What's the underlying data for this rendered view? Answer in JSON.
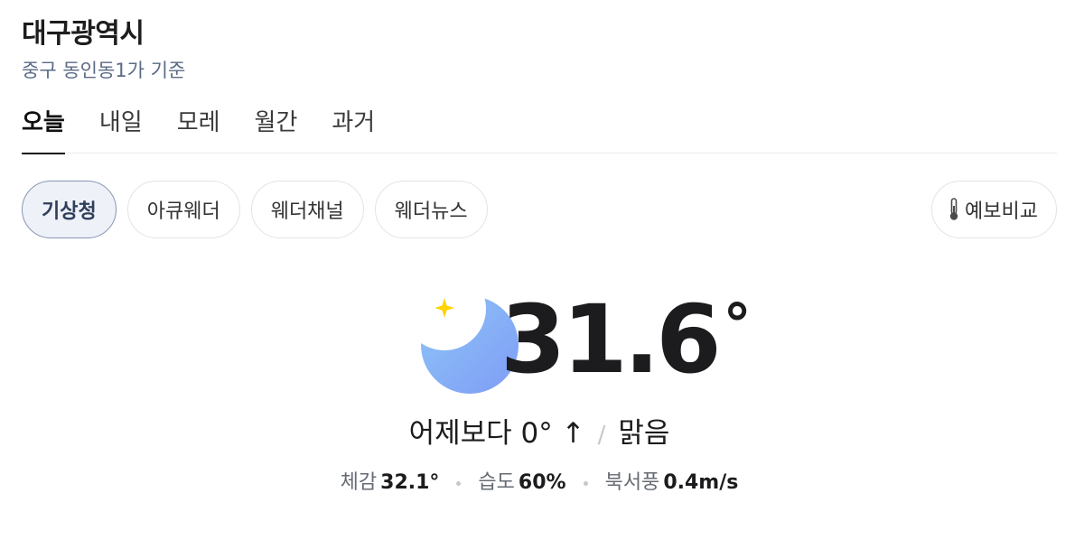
{
  "location": {
    "title": "대구광역시",
    "subtitle": "중구 동인동1가 기준"
  },
  "tabs": [
    {
      "label": "오늘",
      "active": true
    },
    {
      "label": "내일",
      "active": false
    },
    {
      "label": "모레",
      "active": false
    },
    {
      "label": "월간",
      "active": false
    },
    {
      "label": "과거",
      "active": false
    }
  ],
  "sources": [
    {
      "label": "기상청",
      "active": true
    },
    {
      "label": "아큐웨더",
      "active": false
    },
    {
      "label": "웨더채널",
      "active": false
    },
    {
      "label": "웨더뉴스",
      "active": false
    }
  ],
  "compare": {
    "label": "예보비교",
    "icon": "thermometer-icon"
  },
  "current": {
    "icon": "crescent-moon-star-icon",
    "temperature": "31.6",
    "degree_symbol": "°",
    "vs_yesterday": "어제보다 0° ↑",
    "separator": "/",
    "condition": "맑음"
  },
  "details": {
    "feels_like_label": "체감",
    "feels_like_value": "32.1°",
    "humidity_label": "습도",
    "humidity_value": "60%",
    "wind_label": "북서풍",
    "wind_value": "0.4m/s"
  },
  "colors": {
    "active_chip_bg": "#eef1f7",
    "active_chip_border": "#8797b4",
    "subtitle": "#5b6b86",
    "moon_top": "#8ec6f7",
    "moon_bottom": "#7f9cf6",
    "star": "#ffd400"
  }
}
